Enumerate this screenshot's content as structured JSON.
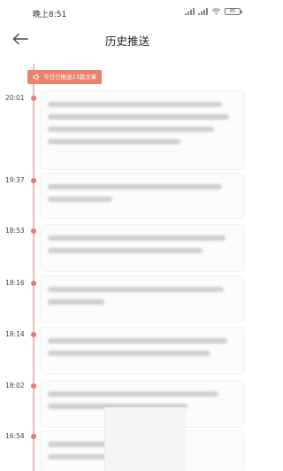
{
  "status": {
    "time": "晚上8:51",
    "battery": "85"
  },
  "header": {
    "title": "历史推送"
  },
  "badge": {
    "text": "今日已推送23篇文章"
  },
  "entries": [
    {
      "time": "20:01"
    },
    {
      "time": "19:37"
    },
    {
      "time": "18:53"
    },
    {
      "time": "18:16"
    },
    {
      "time": "18:14"
    },
    {
      "time": "18:02"
    },
    {
      "time": "16:54"
    }
  ],
  "colors": {
    "accent": "#e27a7a",
    "badge": "#e8826f",
    "timeline": "#f0b8b6"
  }
}
